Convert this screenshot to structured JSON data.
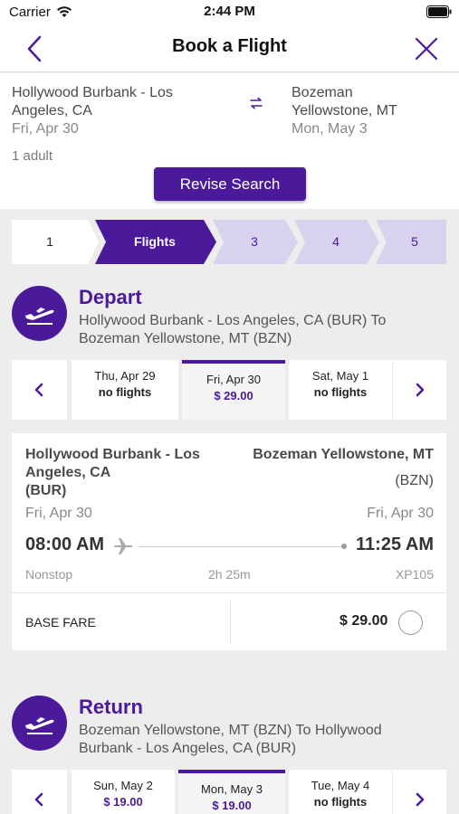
{
  "status": {
    "carrier": "Carrier",
    "time": "2:44 PM"
  },
  "nav": {
    "title": "Book a Flight"
  },
  "search": {
    "origin_line1": "Hollywood Burbank - Los",
    "origin_line2": "Angeles, CA",
    "origin_date": "Fri, Apr 30",
    "dest_line1": "Bozeman",
    "dest_line2": "Yellowstone, MT",
    "dest_date": "Mon, May 3",
    "travelers": "1 adult",
    "revise_label": "Revise Search"
  },
  "steps": [
    {
      "label": "1",
      "state": "done"
    },
    {
      "label": "Flights",
      "state": "active"
    },
    {
      "label": "3",
      "state": "pending"
    },
    {
      "label": "4",
      "state": "pending"
    },
    {
      "label": "5",
      "state": "pending"
    }
  ],
  "depart": {
    "title": "Depart",
    "route_line1": "Hollywood Burbank - Los Angeles, CA (BUR) To",
    "route_line2": "Bozeman Yellowstone, MT (BZN)",
    "dates": [
      {
        "day": "Thu, Apr 29",
        "status": "no flights"
      },
      {
        "day": "Fri, Apr 30",
        "status": "$ 29.00"
      },
      {
        "day": "Sat, May 1",
        "status": "no flights"
      }
    ],
    "flight": {
      "origin_line1": "Hollywood Burbank - Los",
      "origin_line2": "Angeles, CA",
      "origin_line3": "(BUR)",
      "dest_name": "Bozeman Yellowstone, MT",
      "dest_code": "(BZN)",
      "origin_date": "Fri, Apr 30",
      "dest_date": "Fri, Apr 30",
      "depart_time": "08:00 AM",
      "arrive_time": "11:25 AM",
      "stops": "Nonstop",
      "duration": "2h 25m",
      "flight_number": "XP105",
      "fare_label": "BASE FARE",
      "fare_price": "$ 29.00"
    }
  },
  "return": {
    "title": "Return",
    "route_line1": "Bozeman Yellowstone, MT (BZN) To Hollywood",
    "route_line2": "Burbank - Los Angeles, CA (BUR)",
    "dates": [
      {
        "day": "Sun, May 2",
        "status": "$ 19.00"
      },
      {
        "day": "Mon, May 3",
        "status": "$ 19.00"
      },
      {
        "day": "Tue, May 4",
        "status": "no flights"
      }
    ]
  },
  "colors": {
    "brand": "#4b1a9b",
    "step_pending": "#d9d2ee"
  }
}
